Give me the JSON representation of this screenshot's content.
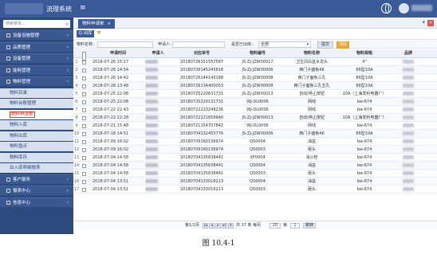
{
  "app": {
    "title": "流理系统",
    "menu_icon": "≡"
  },
  "sidebar": {
    "search_placeholder": "搜索菜单...",
    "items": [
      {
        "label": "设备设施管理",
        "type": "group"
      },
      {
        "label": "品质管理",
        "type": "group"
      },
      {
        "label": "设备管理",
        "type": "group"
      },
      {
        "label": "能耗管理",
        "type": "group"
      },
      {
        "label": "物料管理",
        "type": "group"
      },
      {
        "label": "物料目录",
        "type": "sub"
      },
      {
        "label": "物料台账管理",
        "type": "sub"
      },
      {
        "label": "物料申请单",
        "type": "sub",
        "active": true
      },
      {
        "label": "物料入库",
        "type": "sub"
      },
      {
        "label": "物料出库",
        "type": "sub"
      },
      {
        "label": "物料盘点",
        "type": "sub"
      },
      {
        "label": "物料库存",
        "type": "sub"
      },
      {
        "label": "出入库明细报表",
        "type": "sub"
      },
      {
        "label": "客户服务",
        "type": "group"
      },
      {
        "label": "报表中心",
        "type": "group"
      },
      {
        "label": "信息中心",
        "type": "group"
      }
    ]
  },
  "tabs": {
    "active_label": "物料申请单",
    "close": "×"
  },
  "toolbar": {
    "query_label": "Q.出库"
  },
  "search": {
    "name_label": "物料名称：",
    "applicant_label": "申请人：",
    "status_label": "是否已出库：",
    "status_value": "全部",
    "submit_label": "提交",
    "clear_label": "清除"
  },
  "table": {
    "headers": [
      "申请时间",
      "申请人",
      "对应单号",
      "物料编号",
      "物料名称",
      "物料规格",
      "品牌"
    ],
    "rows": [
      {
        "n": "1",
        "date": "2018-07-26 15:17",
        "order": "20180726151557587",
        "code": "JS-ZJ-JZW00017",
        "name": "卫生间白盆水龙头",
        "spec": "4\""
      },
      {
        "n": "2",
        "date": "2018-07-26 14:54",
        "order": "20180726145245816",
        "code": "JS-ZJ-JZW00006",
        "name": "西门子面板4K",
        "spec": "86型10A"
      },
      {
        "n": "3",
        "date": "2018-07-26 14:42",
        "order": "20180726144145188",
        "code": "JS-ZJ-JZW00008",
        "name": "西门子面板三孔",
        "spec": "86型10A"
      },
      {
        "n": "4",
        "date": "2018-07-26 13:48",
        "order": "20180726134400053",
        "code": "JS-ZJ-JZW00008",
        "name": "西门子面板三孔五孔",
        "spec": "86型10A"
      },
      {
        "n": "5",
        "date": "2018-07-25 22:08",
        "order": "20180725220631731",
        "code": "JS-ZJ-JZW00013",
        "name": "自动/停止按钮",
        "spec": "10A（上海发利电器厂）"
      },
      {
        "n": "6",
        "date": "2018-07-25 22:08",
        "order": "20180725220131731",
        "code": "WJ-DL0006",
        "name": "网线",
        "spec": "bw-674"
      },
      {
        "n": "7",
        "date": "2018-07-22 22:43",
        "order": "20180722223248236",
        "code": "WJ-DL0006",
        "name": "网线",
        "spec": "bw-674"
      },
      {
        "n": "8",
        "date": "2018-07-22 22:28",
        "order": "20180722221659940",
        "code": "JS-ZJ-JZW00013",
        "name": "自动/停止按钮",
        "spec": "10A（上海发利电器厂）"
      },
      {
        "n": "9",
        "date": "2018-07-21 15:48",
        "order": "20180721154707842",
        "code": "WJ-DL0006",
        "name": "网线",
        "spec": "bw-674"
      },
      {
        "n": "10",
        "date": "2018-07-18 14:51",
        "order": "20180704132455776",
        "code": "JS-ZJ-JZW00006",
        "name": "西门子面板4K",
        "spec": "86型10A"
      },
      {
        "n": "11",
        "date": "2018-07-09 16:02",
        "order": "20180709160136974",
        "code": "QS0004",
        "name": "油盆",
        "spec": "bw-674"
      },
      {
        "n": "12",
        "date": "2018-07-09 16:02",
        "order": "20180709160136974",
        "code": "QS0003",
        "name": "砸头",
        "spec": "bw-674"
      },
      {
        "n": "13",
        "date": "2018-07-04 14:58",
        "order": "20180704135638441",
        "code": "XF0004",
        "name": "消火栓",
        "spec": "bw-674"
      },
      {
        "n": "14",
        "date": "2018-07-04 14:58",
        "order": "20180704135638441",
        "code": "QS0004",
        "name": "油盆",
        "spec": "bw-674"
      },
      {
        "n": "15",
        "date": "2018-07-04 14:58",
        "order": "20180704135638441",
        "code": "QS0003",
        "name": "砸头",
        "spec": "bw-674"
      },
      {
        "n": "16",
        "date": "2018-07-04 13:51",
        "order": "20180704133016213",
        "code": "QS0004",
        "name": "油盆",
        "spec": "bw-674"
      },
      {
        "n": "17",
        "date": "2018-07-04 13:51",
        "order": "20180704133016213",
        "code": "QS0003",
        "name": "砸头",
        "spec": "bw-674"
      }
    ]
  },
  "pager": {
    "page_text": "第1/2页",
    "total_text": "共 17 条  每页",
    "page_size": "20",
    "jump_label": "第",
    "page_input": "1",
    "go_label": "跳转"
  },
  "caption": "图 10.4-1"
}
